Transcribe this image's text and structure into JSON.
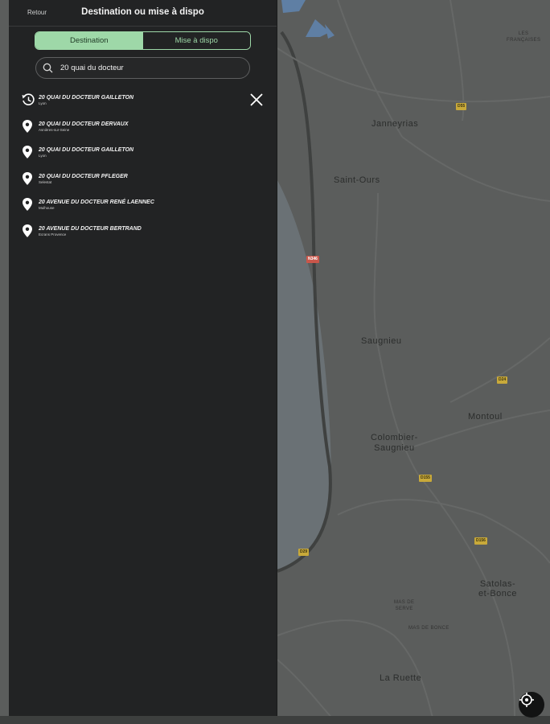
{
  "header": {
    "back_label": "Retour",
    "title": "Destination ou mise à dispo"
  },
  "tabs": [
    {
      "label": "Destination",
      "active": true
    },
    {
      "label": "Mise à dispo",
      "active": false
    }
  ],
  "search": {
    "value": "20 quai du docteur",
    "icon": "search-icon"
  },
  "results": [
    {
      "title": "20 QUAI DU DOCTEUR GAILLETON",
      "subtitle": "Lyon",
      "icon": "history-icon"
    },
    {
      "title": "20 QUAI DU DOCTEUR DERVAUX",
      "subtitle": "Asnières-sur-Seine",
      "icon": "map-pin-icon"
    },
    {
      "title": "20 QUAI DU DOCTEUR GAILLETON",
      "subtitle": "Lyon",
      "icon": "map-pin-icon"
    },
    {
      "title": "20 QUAI DU DOCTEUR PFLEGER",
      "subtitle": "Selestat",
      "icon": "map-pin-icon"
    },
    {
      "title": "20 AVENUE DU DOCTEUR RENÉ LAENNEC",
      "subtitle": "Mulhouse",
      "icon": "map-pin-icon"
    },
    {
      "title": "20 AVENUE DU DOCTEUR BERTRAND",
      "subtitle": "Ecrans Provence",
      "icon": "map-pin-icon"
    }
  ],
  "map": {
    "places": [
      {
        "name": "Janneyrias"
      },
      {
        "name": "Saint-Ours"
      },
      {
        "name": "Saugnieu"
      },
      {
        "name": "Montoul"
      },
      {
        "name": "Colombier-\nSaugnieu"
      },
      {
        "name": "Satolas-\net-Bonce"
      },
      {
        "name": "La Ruette"
      },
      {
        "name": "LES\nFRANÇAISES",
        "small": true
      },
      {
        "name": "MAS DE\nSERVE",
        "small": true
      },
      {
        "name": "MAS DE BONCE",
        "small": true
      }
    ],
    "road_badges": [
      {
        "label": "D55"
      },
      {
        "label": "N346",
        "red": true
      },
      {
        "label": "D24"
      },
      {
        "label": "D155"
      },
      {
        "label": "D29"
      },
      {
        "label": "D156"
      }
    ]
  },
  "colors": {
    "panel_bg": "#222324",
    "accent": "#9ed8a8",
    "map_bg": "#5b5d5c"
  }
}
